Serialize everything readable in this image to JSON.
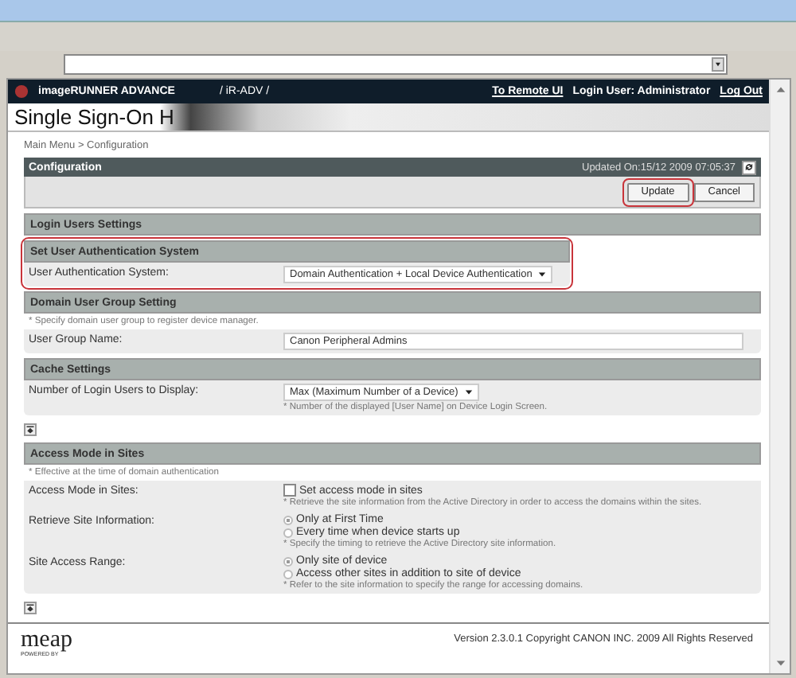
{
  "header": {
    "product": "imageRUNNER ADVANCE",
    "device": "/ iR-ADV /",
    "links": [
      {
        "label": "To Remote UI",
        "kind": "link"
      },
      {
        "label": "Login User: Administrator",
        "kind": "text"
      },
      {
        "label": "Log Out",
        "kind": "link"
      }
    ]
  },
  "title": "Single Sign-On H",
  "breadcrumb": "Main Menu > Configuration",
  "panel": {
    "title": "Configuration",
    "updated": "Updated On:15/12 2009 07:05:37",
    "buttons": [
      {
        "label": "Update",
        "highlighted": true
      },
      {
        "label": "Cancel",
        "highlighted": false
      }
    ]
  },
  "sections": [
    {
      "title": "Login Users Settings",
      "highlighted": false,
      "top_link": false
    },
    {
      "title": "Set User Authentication System",
      "highlighted": true,
      "top_link": false,
      "rows": [
        {
          "label": "User Authentication System:",
          "kind": "select",
          "value": "Domain Authentication + Local Device Authentication"
        }
      ]
    },
    {
      "title": "Domain User Group Setting",
      "hint": "* Specify domain user group to register device manager.",
      "highlighted": false,
      "top_link": false,
      "rows": [
        {
          "label": "User Group Name:",
          "kind": "text",
          "value": "Canon Peripheral Admins"
        }
      ]
    },
    {
      "title": "Cache Settings",
      "highlighted": false,
      "top_link": true,
      "rows": [
        {
          "label": "Number of Login Users to Display:",
          "kind": "select",
          "value": "Max (Maximum Number of a Device)",
          "note": "* Number of the displayed [User Name] on Device Login Screen."
        }
      ]
    },
    {
      "title": "Access Mode in Sites",
      "hint": "* Effective at the time of domain authentication",
      "highlighted": false,
      "top_link": true,
      "rows": [
        {
          "label": "Access Mode in Sites:",
          "kind": "checkbox",
          "options": [
            {
              "label": "Set access mode in sites",
              "selected": false
            }
          ],
          "note": "* Retrieve the site information from the Active Directory in order to access the domains within the sites."
        },
        {
          "label": "Retrieve Site Information:",
          "kind": "radio",
          "options": [
            {
              "label": "Only at First Time",
              "selected": true
            },
            {
              "label": "Every time when device starts up",
              "selected": false
            }
          ],
          "note": "* Specify the timing to retrieve the Active Directory site information."
        },
        {
          "label": "Site Access Range:",
          "kind": "radio",
          "options": [
            {
              "label": "Only site of device",
              "selected": true
            },
            {
              "label": "Access other sites in addition to site of device",
              "selected": false
            }
          ],
          "note": "* Refer to the site information to specify the range for accessing domains."
        }
      ]
    }
  ],
  "footer": {
    "logo": "meap",
    "logo_sub": "POWERED BY",
    "version": "Version 2.3.0.1 Copyright CANON INC. 2009 All Rights Reserved"
  }
}
